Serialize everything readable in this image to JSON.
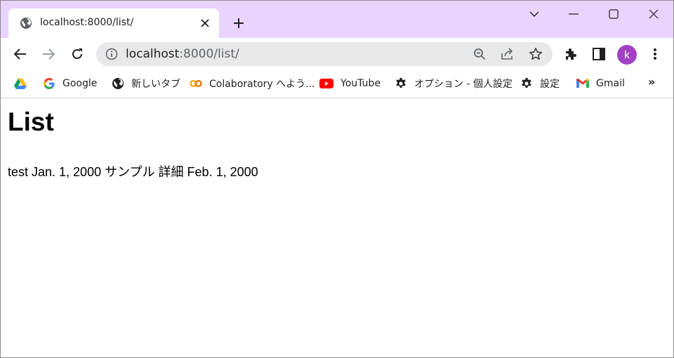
{
  "browser": {
    "tab": {
      "title": "localhost:8000/list/"
    },
    "address_bar": {
      "host": "localhost",
      "rest": ":8000/list/"
    },
    "profile": {
      "initial": "k",
      "color": "#a142c4"
    },
    "accent": "#e9d3ff"
  },
  "bookmarks": [
    {
      "label": "",
      "icon": "google-drive-icon"
    },
    {
      "label": "Google",
      "icon": "google-icon"
    },
    {
      "label": "新しいタブ",
      "icon": "globe-icon"
    },
    {
      "label": "Colaboratory へよう...",
      "icon": "colab-icon"
    },
    {
      "label": "YouTube",
      "icon": "youtube-icon"
    },
    {
      "label": "オプション - 個人設定",
      "icon": "gear-icon"
    },
    {
      "label": "設定",
      "icon": "gear-icon"
    },
    {
      "label": "Gmail",
      "icon": "gmail-icon"
    }
  ],
  "page": {
    "heading": "List",
    "content": "test Jan. 1, 2000 サンプル 詳細 Feb. 1, 2000"
  }
}
